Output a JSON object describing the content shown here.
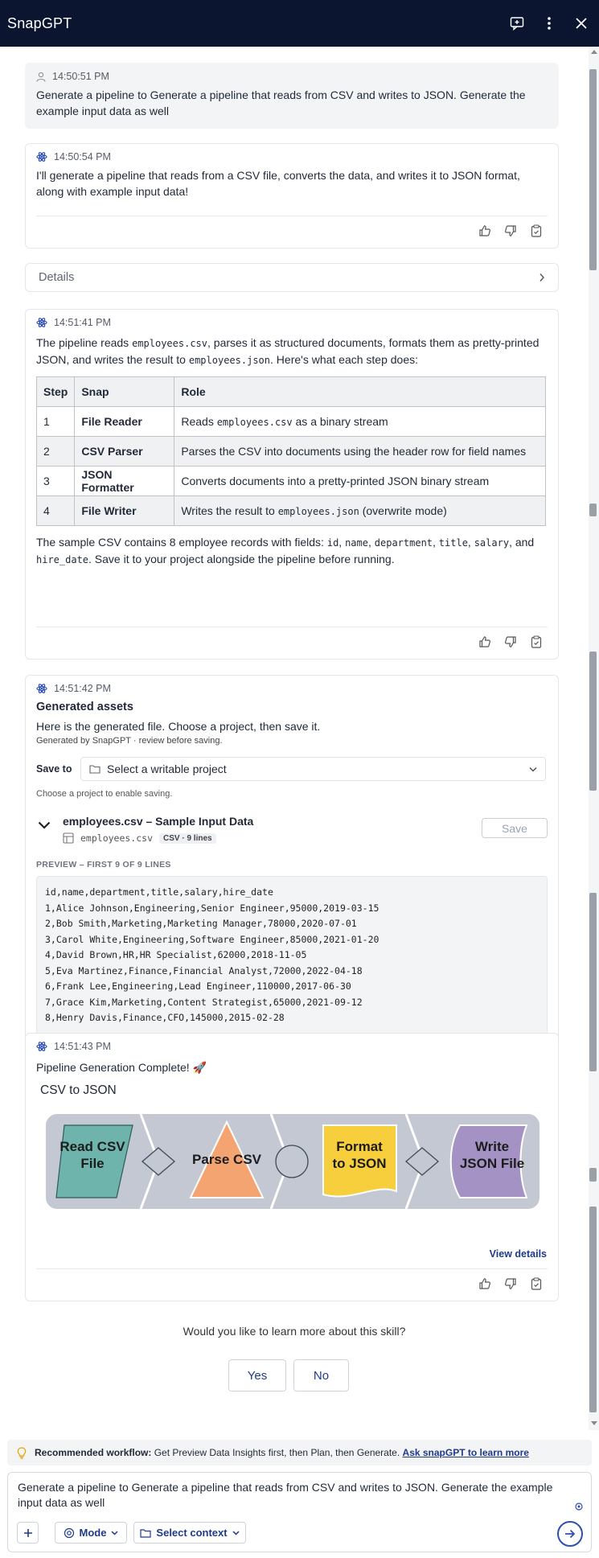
{
  "app": {
    "title": "SnapGPT"
  },
  "icons": {
    "new_chat": "new-chat-icon",
    "more": "more-vertical-icon",
    "close": "close-icon"
  },
  "messages": {
    "user1": {
      "time": "14:50:51 PM",
      "text": "Generate a pipeline to Generate a pipeline that reads from CSV and writes to JSON. Generate the example input data as well"
    },
    "bot1": {
      "time": "14:50:54 PM",
      "text": "I'll generate a pipeline that reads from a CSV file, converts the data, and writes it to JSON format, along with example input data!"
    },
    "details": {
      "label": "Details"
    },
    "bot2": {
      "time": "14:51:41 PM",
      "intro_1": "The pipeline reads ",
      "intro_code1": "employees.csv",
      "intro_2": ", parses it as structured documents, formats them as pretty-printed JSON, and writes the result to ",
      "intro_code2": "employees.json",
      "intro_3": ". Here's what each step does:",
      "table": {
        "headers": [
          "Step",
          "Snap",
          "Role"
        ],
        "rows": [
          {
            "step": "1",
            "snap": "File Reader",
            "role_a": "Reads ",
            "role_code": "employees.csv",
            "role_b": " as a binary stream"
          },
          {
            "step": "2",
            "snap": "CSV Parser",
            "role_a": "Parses the CSV into documents using the header row for field names",
            "role_code": "",
            "role_b": ""
          },
          {
            "step": "3",
            "snap": "JSON Formatter",
            "role_a": "Converts documents into a pretty-printed JSON binary stream",
            "role_code": "",
            "role_b": ""
          },
          {
            "step": "4",
            "snap": "File Writer",
            "role_a": "Writes the result to ",
            "role_code": "employees.json",
            "role_b": " (overwrite mode)"
          }
        ]
      },
      "outro": {
        "a": "The sample CSV contains 8 employee records with fields: ",
        "f1": "id",
        "s1": ", ",
        "f2": "name",
        "s2": ", ",
        "f3": "department",
        "s3": ", ",
        "f4": "title",
        "s4": ", ",
        "f5": "salary",
        "s5": ", and",
        "f6": "hire_date",
        "b": ". Save it to your project alongside the pipeline before running."
      }
    },
    "bot3": {
      "time": "14:51:42 PM",
      "heading": "Generated assets",
      "text": "Here is the generated file. Choose a project, then save it.",
      "note": "Generated by SnapGPT · review before saving.",
      "save_to_label": "Save to",
      "select_placeholder": "Select a writable project",
      "hint": "Choose a project to enable saving.",
      "file": {
        "title": "employees.csv – Sample Input Data",
        "filename": "employees.csv",
        "badge": "CSV · 9 lines",
        "save_label": "Save"
      },
      "preview_label": "PREVIEW – FIRST 9 OF 9 LINES",
      "preview_lines": [
        "id,name,department,title,salary,hire_date",
        "1,Alice Johnson,Engineering,Senior Engineer,95000,2019-03-15",
        "2,Bob Smith,Marketing,Marketing Manager,78000,2020-07-01",
        "3,Carol White,Engineering,Software Engineer,85000,2021-01-20",
        "4,David Brown,HR,HR Specialist,62000,2018-11-05",
        "5,Eva Martinez,Finance,Financial Analyst,72000,2022-04-18",
        "6,Frank Lee,Engineering,Lead Engineer,110000,2017-06-30",
        "7,Grace Kim,Marketing,Content Strategist,65000,2021-09-12",
        "8,Henry Davis,Finance,CFO,145000,2015-02-28"
      ]
    },
    "bot4": {
      "time": "14:51:43 PM",
      "text": "Pipeline Generation Complete! 🚀",
      "pipeline_name": "CSV to JSON",
      "snaps": [
        {
          "line1": "Read CSV",
          "line2": "File"
        },
        {
          "line1": "Parse CSV",
          "line2": ""
        },
        {
          "line1": "Format",
          "line2": "to JSON"
        },
        {
          "line1": "Write",
          "line2": "JSON File"
        }
      ],
      "view_details": "View details"
    }
  },
  "followup": {
    "question": "Would you like to learn more about this skill?",
    "yes": "Yes",
    "no": "No"
  },
  "workflow_tip": {
    "label": "Recommended workflow:",
    "text": " Get Preview Data Insights first, then Plan, then Generate. ",
    "link": "Ask snapGPT to learn more"
  },
  "composer": {
    "value": "Generate a pipeline to Generate a pipeline that reads from CSV and writes to JSON. Generate the example input data as well",
    "mode_label": "Mode",
    "context_label": "Select context"
  },
  "colors": {
    "header_bg": "#0b1530",
    "accent": "#1f3a8a",
    "snap_read": "#6fb3ad",
    "snap_parse": "#f4a470",
    "snap_format": "#f7cf3c",
    "snap_write": "#a392c3",
    "pipeline_bg": "#c4c8d2"
  }
}
